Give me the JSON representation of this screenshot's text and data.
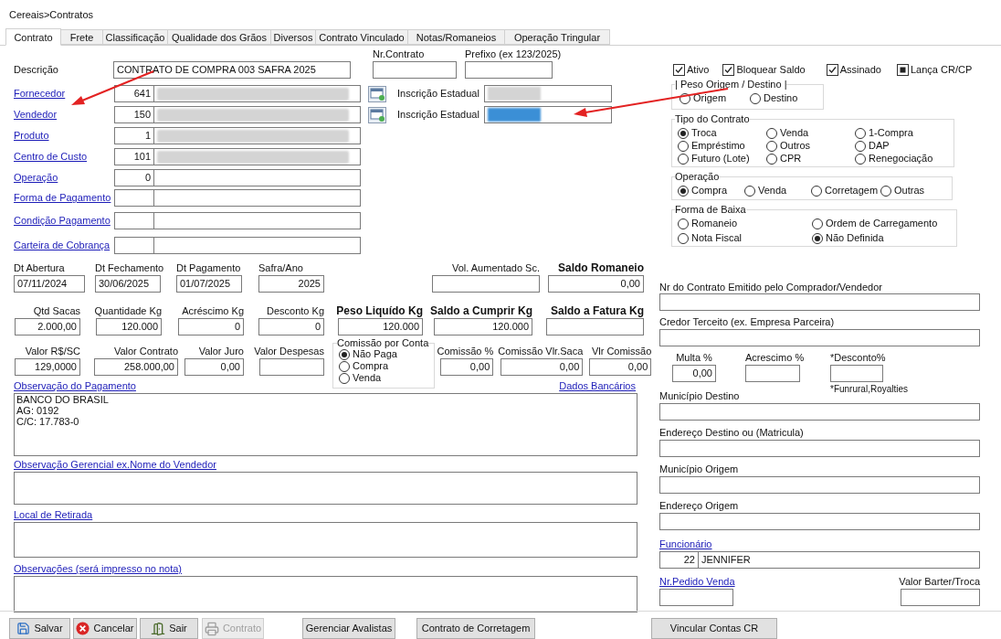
{
  "breadcrumb": "Cereais>Contratos",
  "tabs": [
    {
      "label": "Contrato",
      "selected": true
    },
    {
      "label": "Frete",
      "selected": false
    },
    {
      "label": "Classificação",
      "selected": false
    },
    {
      "label": "Qualidade dos Grãos",
      "selected": false
    },
    {
      "label": "Diversos",
      "selected": false
    },
    {
      "label": "Contrato Vinculado",
      "selected": false
    },
    {
      "label": "Notas/Romaneios",
      "selected": false
    },
    {
      "label": "Operação Tringular",
      "selected": false
    }
  ],
  "descricao": {
    "label": "Descrição",
    "value": "CONTRATO DE COMPRA 003 SAFRA 2025"
  },
  "nr_contrato": {
    "label": "Nr.Contrato"
  },
  "prefixo": {
    "label": "Prefixo (ex 123/2025)"
  },
  "lookups": [
    {
      "label": "Fornecedor",
      "code": "641",
      "redacted": true
    },
    {
      "label": "Vendedor",
      "code": "150",
      "redacted": true
    },
    {
      "label": "Produto",
      "code": "1",
      "redacted": true
    },
    {
      "label": "Centro de Custo",
      "code": "101",
      "redacted": true
    },
    {
      "label": "Operação",
      "code": "0",
      "redacted": false
    },
    {
      "label": "Forma de Pagamento",
      "redacted": false
    },
    {
      "label": "Condição Pagamento",
      "redacted": false
    },
    {
      "label": "Carteira de Cobrança",
      "redacted": false
    }
  ],
  "inscricoes": [
    {
      "label": "Inscrição Estadual",
      "selected": false
    },
    {
      "label": "Inscrição Estadual",
      "selected": true
    }
  ],
  "flags": [
    {
      "label": "Ativo",
      "checked": true,
      "kind": "tick"
    },
    {
      "label": "Bloquear Saldo",
      "checked": true,
      "kind": "tick"
    },
    {
      "label": "Assinado",
      "checked": true,
      "kind": "tick"
    },
    {
      "label": "Lança CR/CP",
      "checked": true,
      "kind": "filled"
    }
  ],
  "radio_groups": [
    {
      "title": "| Peso Origem / Destino |",
      "options": [
        {
          "label": "Origem",
          "selected": false
        },
        {
          "label": "Destino",
          "selected": false
        }
      ]
    },
    {
      "title": "Tipo  do Contrato",
      "options": [
        {
          "label": "Troca",
          "selected": true
        },
        {
          "label": "Venda",
          "selected": false
        },
        {
          "label": "1-Compra",
          "selected": false
        },
        {
          "label": "Empréstimo",
          "selected": false
        },
        {
          "label": "Outros",
          "selected": false
        },
        {
          "label": "DAP",
          "selected": false
        },
        {
          "label": "Futuro (Lote)",
          "selected": false
        },
        {
          "label": "CPR",
          "selected": false
        },
        {
          "label": "Renegociação",
          "selected": false
        }
      ]
    },
    {
      "title": "Operação",
      "options": [
        {
          "label": "Compra",
          "selected": true
        },
        {
          "label": "Venda",
          "selected": false
        },
        {
          "label": "Corretagem",
          "selected": false
        },
        {
          "label": "Outras",
          "selected": false
        }
      ]
    },
    {
      "title": "Forma de Baixa",
      "options": [
        {
          "label": "Romaneio",
          "selected": false
        },
        {
          "label": "Ordem de Carregamento",
          "selected": false
        },
        {
          "label": "Nota Fiscal",
          "selected": false
        },
        {
          "label": "Não Definida",
          "selected": true
        }
      ]
    }
  ],
  "rows": [
    [
      {
        "label": "Dt Abertura",
        "value": "07/11/2024",
        "bold": false
      },
      {
        "label": "Dt Fechamento",
        "value": "30/06/2025",
        "bold": false
      },
      {
        "label": "Dt Pagamento",
        "value": "01/07/2025",
        "bold": false
      },
      {
        "label": "Safra/Ano",
        "value": "2025",
        "bold": false
      },
      {
        "label": "Vol. Aumentado Sc.",
        "bold": false
      },
      {
        "label": "Saldo Romaneio",
        "value": "0,00",
        "bold": true
      }
    ],
    [
      {
        "label": "Qtd Sacas",
        "value": "2.000,00",
        "bold": false
      },
      {
        "label": "Quantidade Kg",
        "value": "120.000",
        "bold": false
      },
      {
        "label": "Acréscimo Kg",
        "value": "0",
        "bold": false
      },
      {
        "label": "Desconto Kg",
        "value": "0",
        "bold": false
      },
      {
        "label": "Peso Liquído Kg",
        "value": "120.000",
        "bold": true
      },
      {
        "label": "Saldo a Cumprir Kg",
        "value": "120.000",
        "bold": true
      },
      {
        "label": "Saldo a Fatura Kg",
        "bold": true
      }
    ],
    [
      {
        "label": "Valor R$/SC",
        "value": "129,0000",
        "bold": false
      },
      {
        "label": "Valor Contrato",
        "value": "258.000,00",
        "bold": false
      },
      {
        "label": "Valor Juro",
        "value": "0,00",
        "bold": false
      },
      {
        "label": "Valor Despesas",
        "bold": false
      },
      {
        "label": "Comissão %",
        "value": "0,00",
        "bold": false
      },
      {
        "label": "Comissão Vlr.Saca",
        "value": "0,00",
        "bold": false
      },
      {
        "label": "Vlr Comissão",
        "value": "0,00",
        "bold": false
      }
    ]
  ],
  "comissao": {
    "title": "Comissão por Conta",
    "options": [
      {
        "label": "Não Paga",
        "selected": true
      },
      {
        "label": "Compra",
        "selected": false
      },
      {
        "label": "Venda",
        "selected": false
      }
    ]
  },
  "dados_bancarios": "Dados Bancários",
  "observacoes": [
    {
      "label": "Observação do Pagamento",
      "value": "BANCO DO BRASIL\nAG: 0192\nC/C: 17.783-0"
    },
    {
      "label": "Observação Gerencial ex.Nome do Vendedor"
    },
    {
      "label": "Local de Retirada"
    },
    {
      "label": "Observações (será impresso no nota)"
    }
  ],
  "right": {
    "nr_emitido": {
      "label": "Nr do Contrato Emitido pelo Comprador/Vendedor"
    },
    "credor": {
      "label": "Credor Terceito (ex. Empresa Parceira)"
    },
    "percent_fields": [
      {
        "label": "Multa %",
        "value": "0,00"
      },
      {
        "label": "Acrescimo %"
      },
      {
        "label": "*Desconto%"
      }
    ],
    "note": "*Funrural,Royalties",
    "address_fields": [
      {
        "label": "Município Destino"
      },
      {
        "label": "Endereço Destino ou (Matricula)"
      },
      {
        "label": "Município Origem"
      },
      {
        "label": "Endereço Origem"
      }
    ],
    "funcionario": {
      "label": "Funcionário",
      "code": "22",
      "name": "JENNIFER"
    },
    "pedido": {
      "label": "Nr.Pedido Venda"
    },
    "barter": {
      "label": "Valor Barter/Troca"
    }
  },
  "buttons": [
    {
      "label": "Salvar",
      "kind": "save",
      "disabled": false
    },
    {
      "label": "Cancelar",
      "kind": "cancel",
      "disabled": false
    },
    {
      "label": "Sair",
      "kind": "exit",
      "disabled": false
    },
    {
      "label": "Contrato",
      "kind": "print",
      "disabled": true
    },
    {
      "label": "Gerenciar Avalistas",
      "kind": "plain",
      "disabled": false
    },
    {
      "label": "Contrato de Corretagem",
      "kind": "plain",
      "disabled": false
    },
    {
      "label": "Vincular Contas CR",
      "kind": "plain",
      "disabled": false
    }
  ]
}
